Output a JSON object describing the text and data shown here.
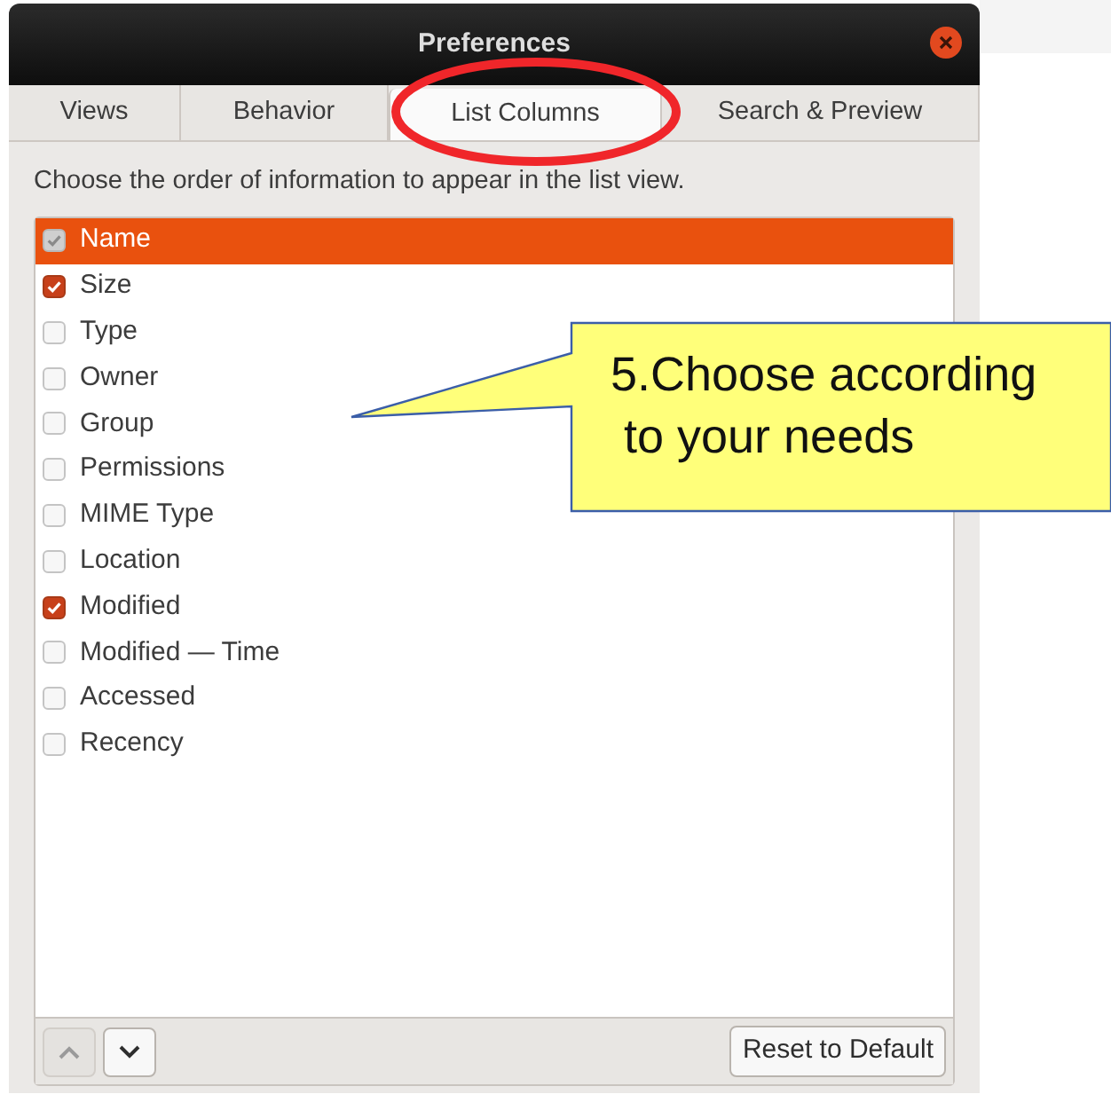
{
  "window": {
    "title": "Preferences"
  },
  "tabs": [
    {
      "label": "Views",
      "selected": false
    },
    {
      "label": "Behavior",
      "selected": false
    },
    {
      "label": "List Columns",
      "selected": true
    },
    {
      "label": "Search & Preview",
      "selected": false
    }
  ],
  "description": "Choose the order of information to appear in the list view.",
  "columns": [
    {
      "label": "Name",
      "checked": true,
      "selected": true,
      "disabled": true
    },
    {
      "label": "Size",
      "checked": true,
      "selected": false,
      "disabled": false
    },
    {
      "label": "Type",
      "checked": false,
      "selected": false,
      "disabled": false
    },
    {
      "label": "Owner",
      "checked": false,
      "selected": false,
      "disabled": false
    },
    {
      "label": "Group",
      "checked": false,
      "selected": false,
      "disabled": false
    },
    {
      "label": "Permissions",
      "checked": false,
      "selected": false,
      "disabled": false
    },
    {
      "label": "MIME Type",
      "checked": false,
      "selected": false,
      "disabled": false
    },
    {
      "label": "Location",
      "checked": false,
      "selected": false,
      "disabled": false
    },
    {
      "label": "Modified",
      "checked": true,
      "selected": false,
      "disabled": false
    },
    {
      "label": "Modified — Time",
      "checked": false,
      "selected": false,
      "disabled": false
    },
    {
      "label": "Accessed",
      "checked": false,
      "selected": false,
      "disabled": false
    },
    {
      "label": "Recency",
      "checked": false,
      "selected": false,
      "disabled": false
    }
  ],
  "move_buttons": [
    {
      "kind": "up",
      "disabled": true
    },
    {
      "kind": "down",
      "disabled": false
    }
  ],
  "reset_button": "Reset to Default",
  "callout": "5.Choose according\n to your needs"
}
